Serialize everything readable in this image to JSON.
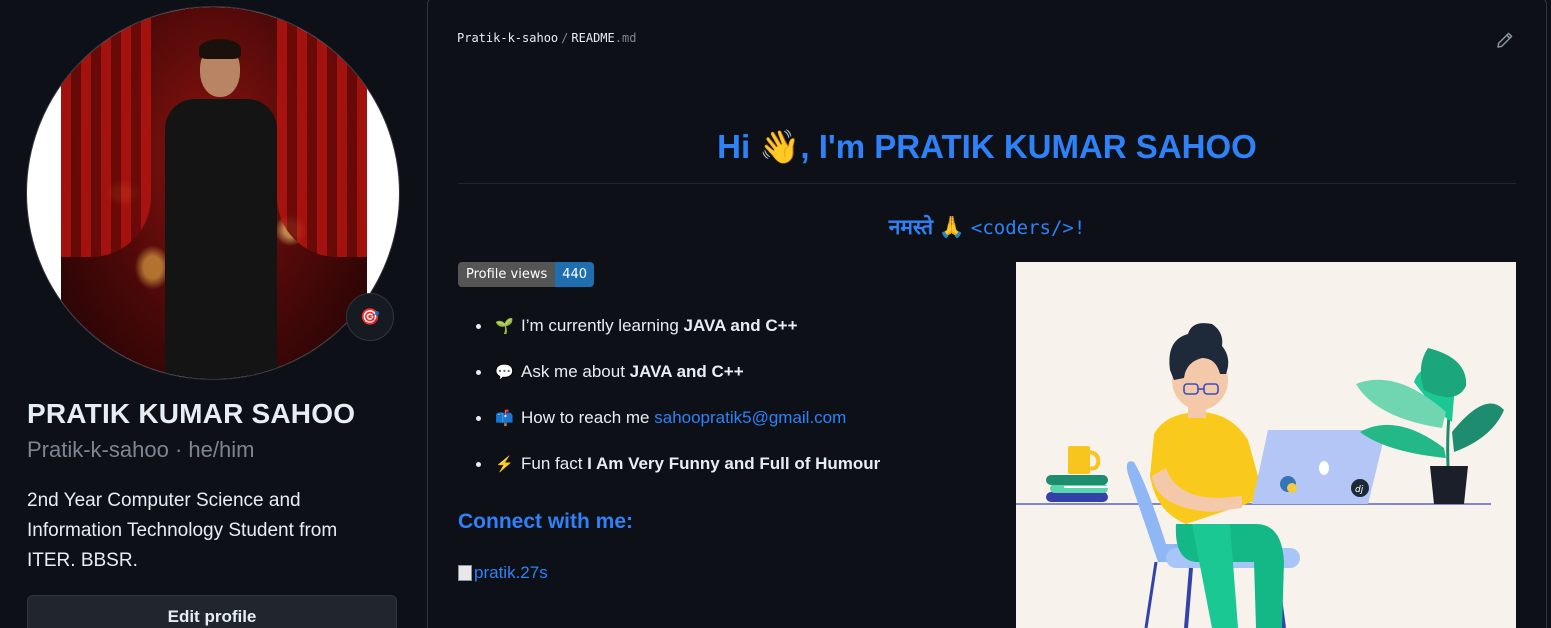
{
  "profile": {
    "name": "PRATIK KUMAR SAHOO",
    "login_line": "Pratik-k-sahoo · he/him",
    "bio": "2nd Year Computer Science and Information Technology Student from ITER. BBSR.",
    "edit_button": "Edit profile",
    "status_emoji": "🎯"
  },
  "readme": {
    "path_owner": "Pratik-k-sahoo",
    "path_sep": "/",
    "path_file": "README",
    "path_ext": ".md",
    "title": "Hi 👋, I'm PRATIK KUMAR SAHOO",
    "greeting_text": "नमस्ते 🙏",
    "greeting_code": "<coders/>!",
    "views_label": "Profile views",
    "views_count": "440",
    "facts": [
      {
        "emoji": "🌱",
        "text": "I’m currently learning ",
        "strong": "JAVA and C++"
      },
      {
        "emoji": "💬",
        "text": "Ask me about ",
        "strong": "JAVA and C++"
      },
      {
        "emoji": "📫",
        "text": "How to reach me ",
        "link": "sahoopratik5@gmail.com"
      },
      {
        "emoji": "⚡",
        "text": "Fun fact ",
        "strong": "I Am Very Funny and Full of Humour"
      }
    ],
    "connect_heading": "Connect with me:",
    "social_alt": "pratik.27s"
  },
  "colors": {
    "accent": "#2f81f7",
    "background": "#0d1117",
    "border": "#30363d",
    "muted": "#7d8590"
  },
  "icons": {
    "edit": "pencil-icon",
    "status": "target-icon"
  }
}
